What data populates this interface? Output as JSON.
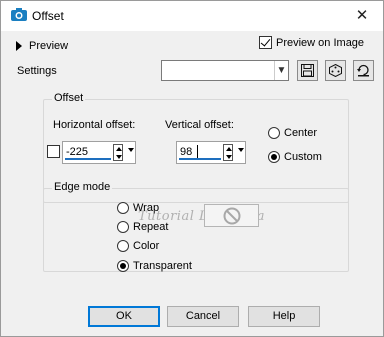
{
  "window": {
    "title": "Offset",
    "close_glyph": "✕"
  },
  "preview": {
    "label": "Preview"
  },
  "preview_on_image": {
    "label": "Preview on Image",
    "checked": true
  },
  "settings": {
    "label": "Settings",
    "value": ""
  },
  "offset_group": {
    "title": "Offset",
    "horizontal": {
      "label": "Horizontal offset:",
      "value": "-225"
    },
    "vertical": {
      "label": "Vertical offset:",
      "value": "98"
    },
    "options": [
      {
        "label": "Center",
        "selected": false
      },
      {
        "label": "Custom",
        "selected": true
      }
    ]
  },
  "edge_mode": {
    "title": "Edge mode",
    "options": [
      {
        "label": "Wrap",
        "selected": false
      },
      {
        "label": "Repeat",
        "selected": false
      },
      {
        "label": "Color",
        "selected": false
      },
      {
        "label": "Transparent",
        "selected": true
      }
    ]
  },
  "watermark": "Tutorial Lisa Cida",
  "buttons": {
    "ok": "OK",
    "cancel": "Cancel",
    "help": "Help"
  },
  "colors": {
    "accent": "#0078d7",
    "input_underline": "#1e6fbf"
  }
}
